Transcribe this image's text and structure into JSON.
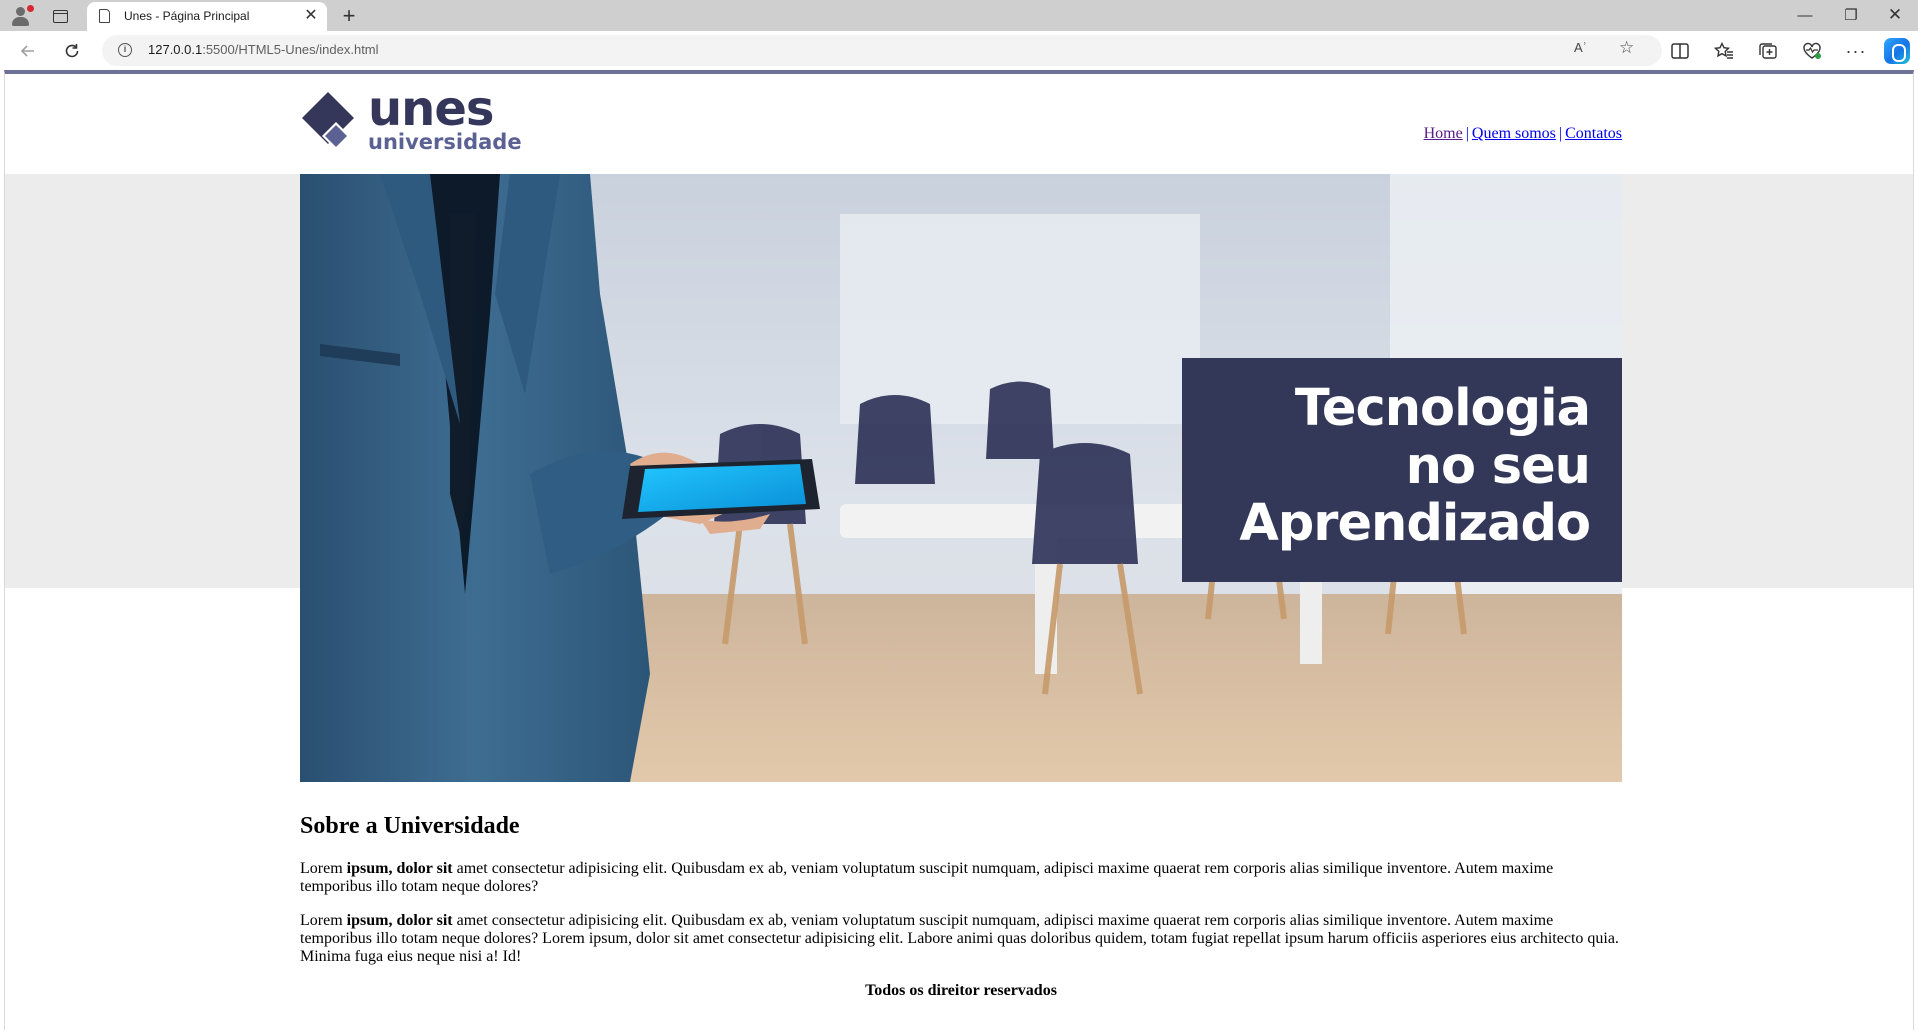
{
  "browser": {
    "tab_title": "Unes - Página Principal",
    "tab_close_glyph": "✕",
    "new_tab_glyph": "+",
    "url_host": "127.0.0.1",
    "url_rest": ":5500/HTML5-Unes/index.html",
    "read_aloud_glyph": "Aʾ",
    "window_controls": {
      "minimize": "—",
      "maximize": "❐",
      "close": "✕"
    },
    "icons": [
      "profile-icon",
      "tab-actions-icon",
      "page-icon",
      "back-icon",
      "reload-icon",
      "info-icon",
      "read-aloud-icon",
      "favorite-star-icon",
      "split-screen-icon",
      "favorites-icon",
      "collections-icon",
      "browser-essentials-icon",
      "more-icon",
      "copilot-icon"
    ]
  },
  "site": {
    "logo": {
      "word": "unes",
      "sub": "universidade",
      "colors": {
        "dark": "#34375a",
        "light": "#5c6194"
      }
    },
    "nav": [
      {
        "label": "Home"
      },
      {
        "label": "Quem somos"
      },
      {
        "label": "Contatos"
      }
    ],
    "nav_separator": "|",
    "banner": {
      "lines": [
        "Tecnologia",
        "no seu",
        "Aprendizado"
      ],
      "box_color": "#333859"
    },
    "about": {
      "heading": "Sobre a Universidade",
      "p1": {
        "before": "Lorem ",
        "bold": "ipsum, dolor sit",
        "after": " amet consectetur adipisicing elit. Quibusdam ex ab, veniam voluptatum suscipit numquam, adipisci maxime quaerat rem corporis alias similique inventore. Autem maxime temporibus illo totam neque dolores?"
      },
      "p2": {
        "before": "Lorem ",
        "bold": "ipsum, dolor sit",
        "after": " amet consectetur adipisicing elit. Quibusdam ex ab, veniam voluptatum suscipit numquam, adipisci maxime quaerat rem corporis alias similique inventore. Autem maxime temporibus illo totam neque dolores? Lorem ipsum, dolor sit amet consectetur adipisicing elit. Labore animi quas doloribus quidem, totam fugiat repellat ipsum harum officiis asperiores eius architecto quia. Minima fuga eius neque nisi a! Id!"
      }
    },
    "footer": "Todos os direitor reservados"
  }
}
